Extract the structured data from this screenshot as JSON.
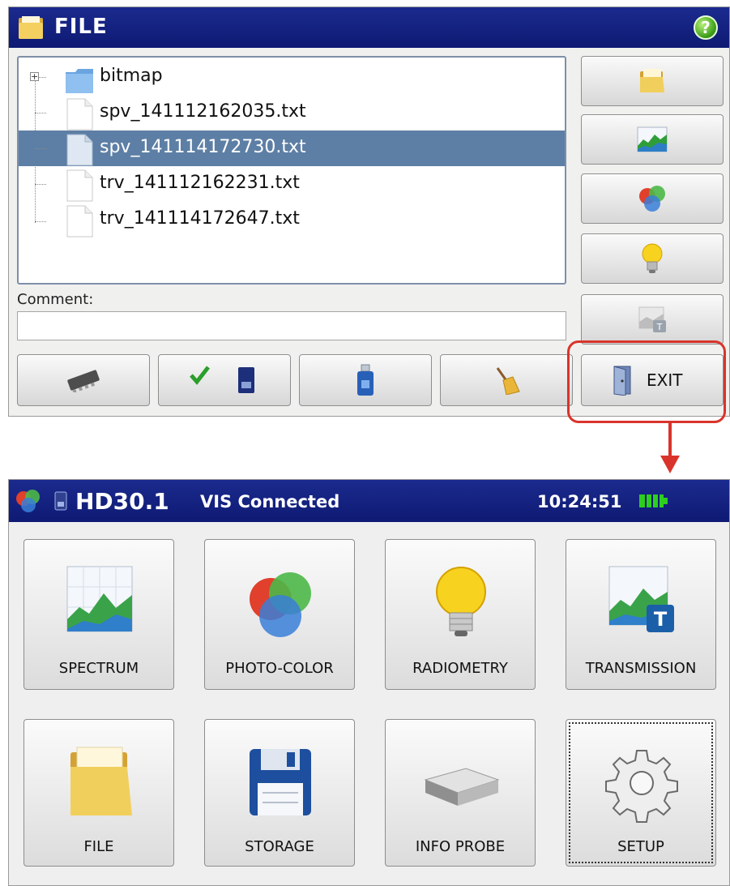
{
  "file_screen": {
    "title": "FILE",
    "help_label": "?",
    "tree": [
      {
        "name": "bitmap",
        "type": "folder",
        "selected": false
      },
      {
        "name": "spv_141112162035.txt",
        "type": "file",
        "selected": false
      },
      {
        "name": "spv_141114172730.txt",
        "type": "file",
        "selected": true
      },
      {
        "name": "trv_141112162231.txt",
        "type": "file",
        "selected": false
      },
      {
        "name": "trv_141114172647.txt",
        "type": "file",
        "selected": false
      }
    ],
    "comment_label": "Comment:",
    "comment_value": "",
    "side_buttons": [
      "folder-icon",
      "spectrum-chart-icon",
      "photo-color-icon",
      "lightbulb-icon",
      "transmission-icon"
    ],
    "bottom_buttons": [
      "memory-chip-icon",
      "sd-card-check-icon",
      "usb-drive-icon",
      "broom-icon"
    ],
    "exit_label": "EXIT"
  },
  "main_screen": {
    "model": "HD30.1",
    "connection": "VIS Connected",
    "clock": "10:24:51",
    "tiles": [
      {
        "label": "SPECTRUM",
        "icon": "spectrum-chart-icon"
      },
      {
        "label": "PHOTO-COLOR",
        "icon": "photo-color-icon"
      },
      {
        "label": "RADIOMETRY",
        "icon": "lightbulb-icon"
      },
      {
        "label": "TRANSMISSION",
        "icon": "transmission-icon"
      },
      {
        "label": "FILE",
        "icon": "folder-icon"
      },
      {
        "label": "STORAGE",
        "icon": "floppy-disk-icon"
      },
      {
        "label": "INFO PROBE",
        "icon": "probe-device-icon"
      },
      {
        "label": "SETUP",
        "icon": "gear-icon"
      }
    ]
  },
  "colors": {
    "title_bar": "#1b2a8e",
    "selection": "#5d7fa5",
    "highlight": "#d9342b"
  }
}
